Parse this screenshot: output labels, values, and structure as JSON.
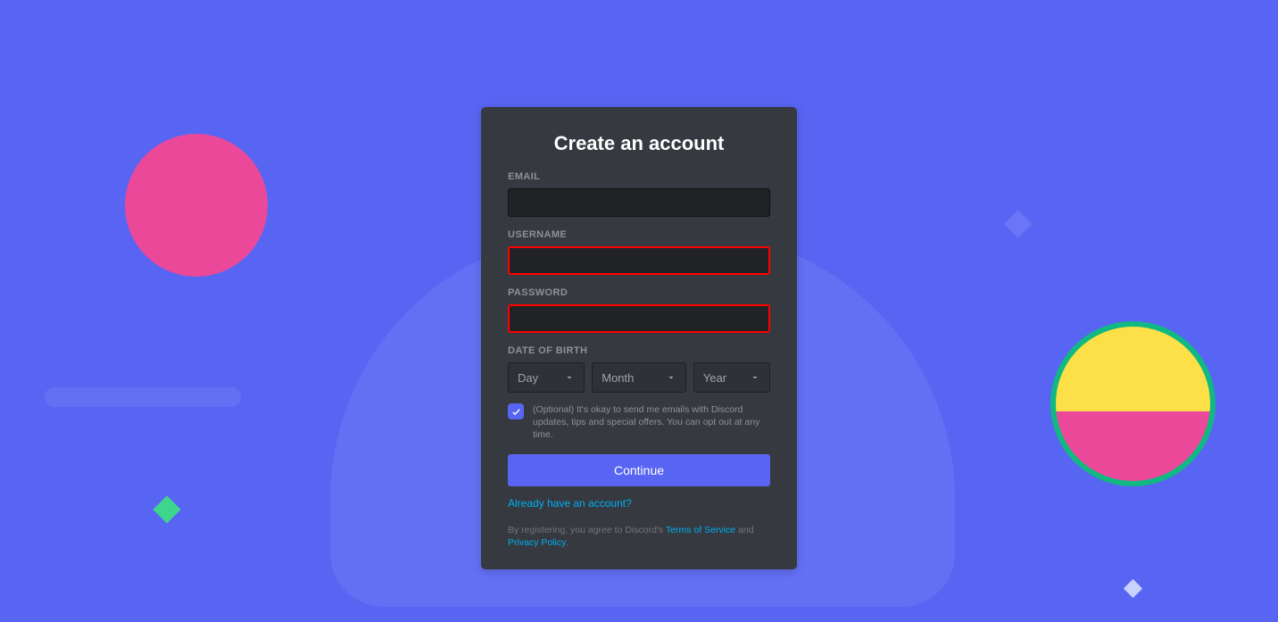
{
  "title": "Create an account",
  "fields": {
    "email_label": "EMAIL",
    "username_label": "USERNAME",
    "password_label": "PASSWORD",
    "dob_label": "DATE OF BIRTH"
  },
  "dob": {
    "day_placeholder": "Day",
    "month_placeholder": "Month",
    "year_placeholder": "Year"
  },
  "marketing_opt_text": "(Optional) It's okay to send me emails with Discord updates, tips and special offers. You can opt out at any time.",
  "marketing_opt_checked": true,
  "continue_label": "Continue",
  "login_link_text": "Already have an account?",
  "fineprint": {
    "prefix": "By registering, you agree to Discord's ",
    "tos": "Terms of Service",
    "and": " and ",
    "privacy": "Privacy Policy",
    "suffix": "."
  },
  "highlighted_fields": [
    "username",
    "password"
  ]
}
